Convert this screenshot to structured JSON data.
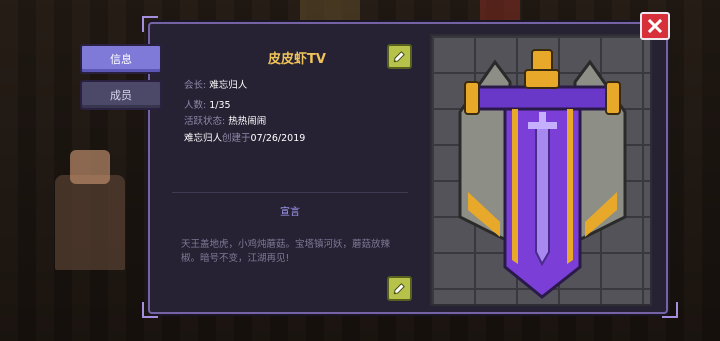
{
  "tabs": [
    {
      "label": "信息",
      "active": true
    },
    {
      "label": "成员",
      "active": false
    }
  ],
  "guild": {
    "name": "皮皮虾TV",
    "leader_label": "会长:",
    "leader": "难忘归人",
    "members_label": "人数:",
    "members": "1/35",
    "activity_label": "活跃状态:",
    "activity": "热热闹闹",
    "creator": "难忘归人",
    "created_label": "创建于",
    "created_date": "07/26/2019"
  },
  "declaration": {
    "title": "宣言",
    "text": "天王盖地虎，小鸡炖蘑菇。宝塔镇河妖，蘑菇放辣椒。暗号不变，江湖再见!"
  },
  "icons": {
    "edit": "pencil-icon",
    "close": "close-icon"
  },
  "colors": {
    "guild_name": "#f0c35a",
    "active_tab": "#7f7ad8",
    "close_button": "#d7303a",
    "edit_button": "#b7c24a",
    "emblem_purple": "#7b3fd8",
    "emblem_gold": "#e8a92a"
  }
}
